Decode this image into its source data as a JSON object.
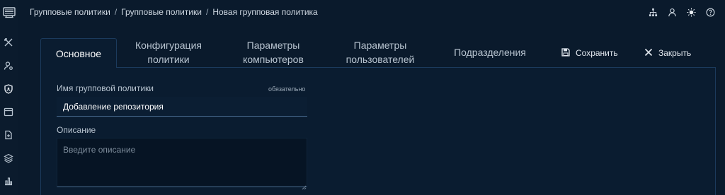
{
  "breadcrumb": {
    "items": [
      "Групповые политики",
      "Групповые политики",
      "Новая групповая политика"
    ],
    "separator": "/"
  },
  "topbar": {
    "icons": [
      "sitemap-icon",
      "user-icon",
      "sun-icon",
      "help-icon"
    ]
  },
  "sidebar": {
    "logo": "app-logo-icon",
    "icons": [
      "tools-icon",
      "user-settings-icon",
      "shield-icon",
      "calendar-icon",
      "document-icon",
      "layers-icon",
      "chart-icon"
    ]
  },
  "tabs": {
    "active": "Основное",
    "items": [
      {
        "line1": "Конфигурация",
        "line2": "политики"
      },
      {
        "line1": "Параметры",
        "line2": "компьютеров"
      },
      {
        "line1": "Параметры",
        "line2": "пользователей"
      },
      {
        "line1": "Подразделения",
        "line2": ""
      }
    ]
  },
  "actions": {
    "save": "Сохранить",
    "close": "Закрыть"
  },
  "form": {
    "name_label": "Имя групповой политики",
    "name_required": "обязательно",
    "name_value": "Добавление репозитория",
    "description_label": "Описание",
    "description_placeholder": "Введите описание"
  },
  "colors": {
    "background": "#0a1a2c",
    "panel_border": "#1b3a5c",
    "accent": "#4a6d92"
  }
}
